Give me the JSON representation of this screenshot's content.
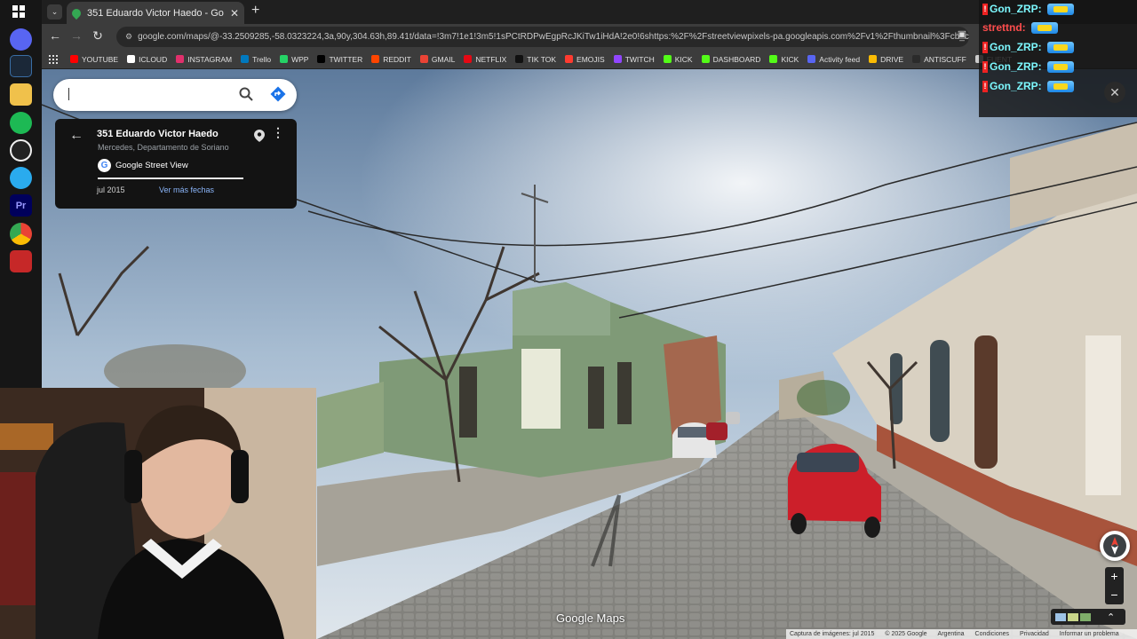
{
  "browser": {
    "tab_title": "351 Eduardo Victor Haedo - Go",
    "tab_close": "✕",
    "new_tab": "+",
    "tab_menu": "⌄",
    "url": "google.com/maps/@-33.2509285,-58.0323224,3a,90y,304.63h,89.41t/data=!3m7!1e1!3m5!1sPCtRDPwEgpRcJKiTw1iHdA!2e0!6shttps:%2F%2Fstreetviewpixels-pa.googleapis.com%2Fv1%2Fthumbnail%3Fcb_client%3Dmaps...",
    "back": "←",
    "forward": "→",
    "reload": "↻"
  },
  "bookmarks": [
    {
      "label": "YOUTUBE",
      "color": "#ff0000"
    },
    {
      "label": "ICLOUD",
      "color": "#ffffff"
    },
    {
      "label": "INSTAGRAM",
      "color": "#e1306c"
    },
    {
      "label": "Trello",
      "color": "#0079bf"
    },
    {
      "label": "WPP",
      "color": "#25d366"
    },
    {
      "label": "TWITTER",
      "color": "#000000"
    },
    {
      "label": "REDDIT",
      "color": "#ff4500"
    },
    {
      "label": "GMAIL",
      "color": "#ea4335"
    },
    {
      "label": "NETFLIX",
      "color": "#e50914"
    },
    {
      "label": "TIK TOK",
      "color": "#111111"
    },
    {
      "label": "EMOJIS",
      "color": "#ff3b30"
    },
    {
      "label": "TWITCH",
      "color": "#9146ff"
    },
    {
      "label": "KICK",
      "color": "#53fc18"
    },
    {
      "label": "DASHBOARD",
      "color": "#53fc18"
    },
    {
      "label": "KICK",
      "color": "#53fc18"
    },
    {
      "label": "Activity feed",
      "color": "#5865f2"
    },
    {
      "label": "DRIVE",
      "color": "#fbbc04"
    },
    {
      "label": "ANTISCUFF",
      "color": "#2b2b2b"
    },
    {
      "label": "FUENT",
      "color": "#cccccc"
    }
  ],
  "card": {
    "address": "351 Eduardo Victor Haedo",
    "region": "Mercedes, Departamento de Soriano",
    "source": "Google Street View",
    "date": "jul 2015",
    "more_dates": "Ver más fechas",
    "back": "←",
    "more": "⋮"
  },
  "chat": {
    "messages": [
      {
        "user": "Gon_ZRP:",
        "color": "#7df9ff",
        "badge": true
      },
      {
        "user": "strettnd:",
        "color": "#ff4d4d",
        "badge": false
      },
      {
        "user": "Gon_ZRP:",
        "color": "#7df9ff",
        "badge": true
      },
      {
        "user": "Gon_ZRP:",
        "color": "#7df9ff",
        "badge": true
      },
      {
        "user": "Gon_ZRP:",
        "color": "#7df9ff",
        "badge": true
      }
    ],
    "close": "✕"
  },
  "map_controls": {
    "zoom_in": "+",
    "zoom_out": "−",
    "expand": "⌃",
    "brand": "Google Maps"
  },
  "footer": {
    "capture": "Captura de imágenes: jul 2015",
    "copyright": "© 2025 Google",
    "country": "Argentina",
    "terms": "Condiciones",
    "privacy": "Privacidad",
    "report": "Informar un problema"
  }
}
